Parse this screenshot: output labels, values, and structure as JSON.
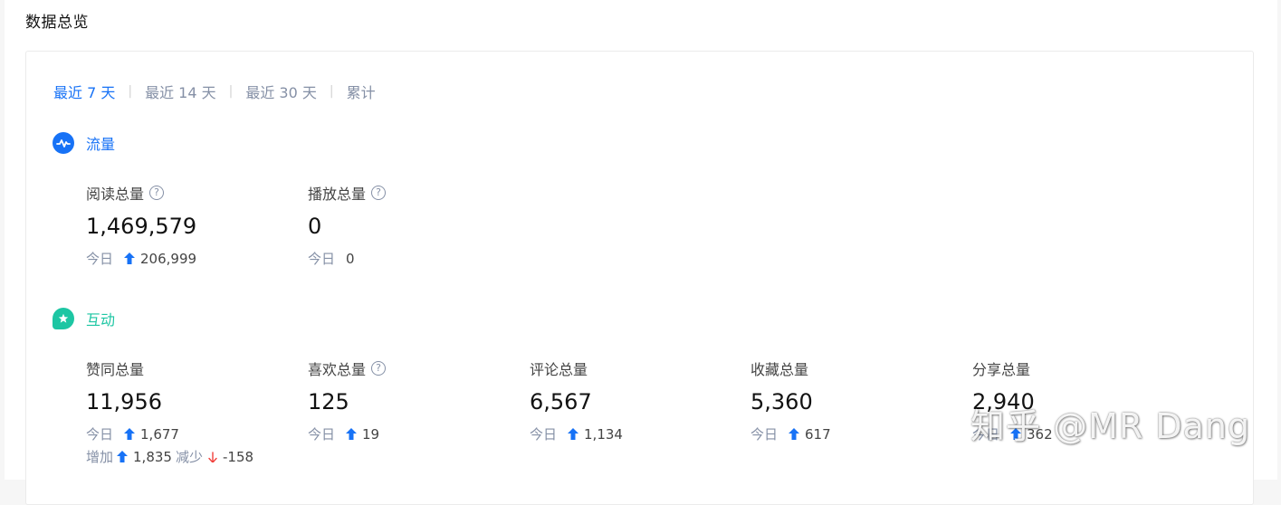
{
  "page_title": "数据总览",
  "tabs": [
    {
      "label": "最近 7 天",
      "active": true
    },
    {
      "label": "最近 14 天",
      "active": false
    },
    {
      "label": "最近 30 天",
      "active": false
    },
    {
      "label": "累计",
      "active": false
    }
  ],
  "traffic": {
    "title": "流量",
    "icon": "pulse-icon",
    "color": "#1772f6",
    "metrics": [
      {
        "label": "阅读总量",
        "value": "1,469,579",
        "today_label": "今日",
        "today_delta": "206,999",
        "has_help": true
      },
      {
        "label": "播放总量",
        "value": "0",
        "today_label": "今日",
        "today_delta": "0",
        "has_help": true
      }
    ]
  },
  "interaction": {
    "title": "互动",
    "icon": "star-chat-icon",
    "color": "#1dc6a3",
    "metrics": [
      {
        "label": "赞同总量",
        "value": "11,956",
        "today_label": "今日",
        "today_delta": "1,677",
        "has_help": false,
        "increase_label": "增加",
        "increase_value": "1,835",
        "decrease_label": "减少",
        "decrease_value": "-158"
      },
      {
        "label": "喜欢总量",
        "value": "125",
        "today_label": "今日",
        "today_delta": "19",
        "has_help": true
      },
      {
        "label": "评论总量",
        "value": "6,567",
        "today_label": "今日",
        "today_delta": "1,134",
        "has_help": false
      },
      {
        "label": "收藏总量",
        "value": "5,360",
        "today_label": "今日",
        "today_delta": "617",
        "has_help": false
      },
      {
        "label": "分享总量",
        "value": "2,940",
        "today_label": "今日",
        "today_delta": "362",
        "has_help": false
      }
    ]
  },
  "colors": {
    "accent": "#1772f6",
    "up": "#1772f6",
    "down": "#f1403c",
    "muted": "#8590a6"
  },
  "watermark": "知乎 @MR Dang"
}
